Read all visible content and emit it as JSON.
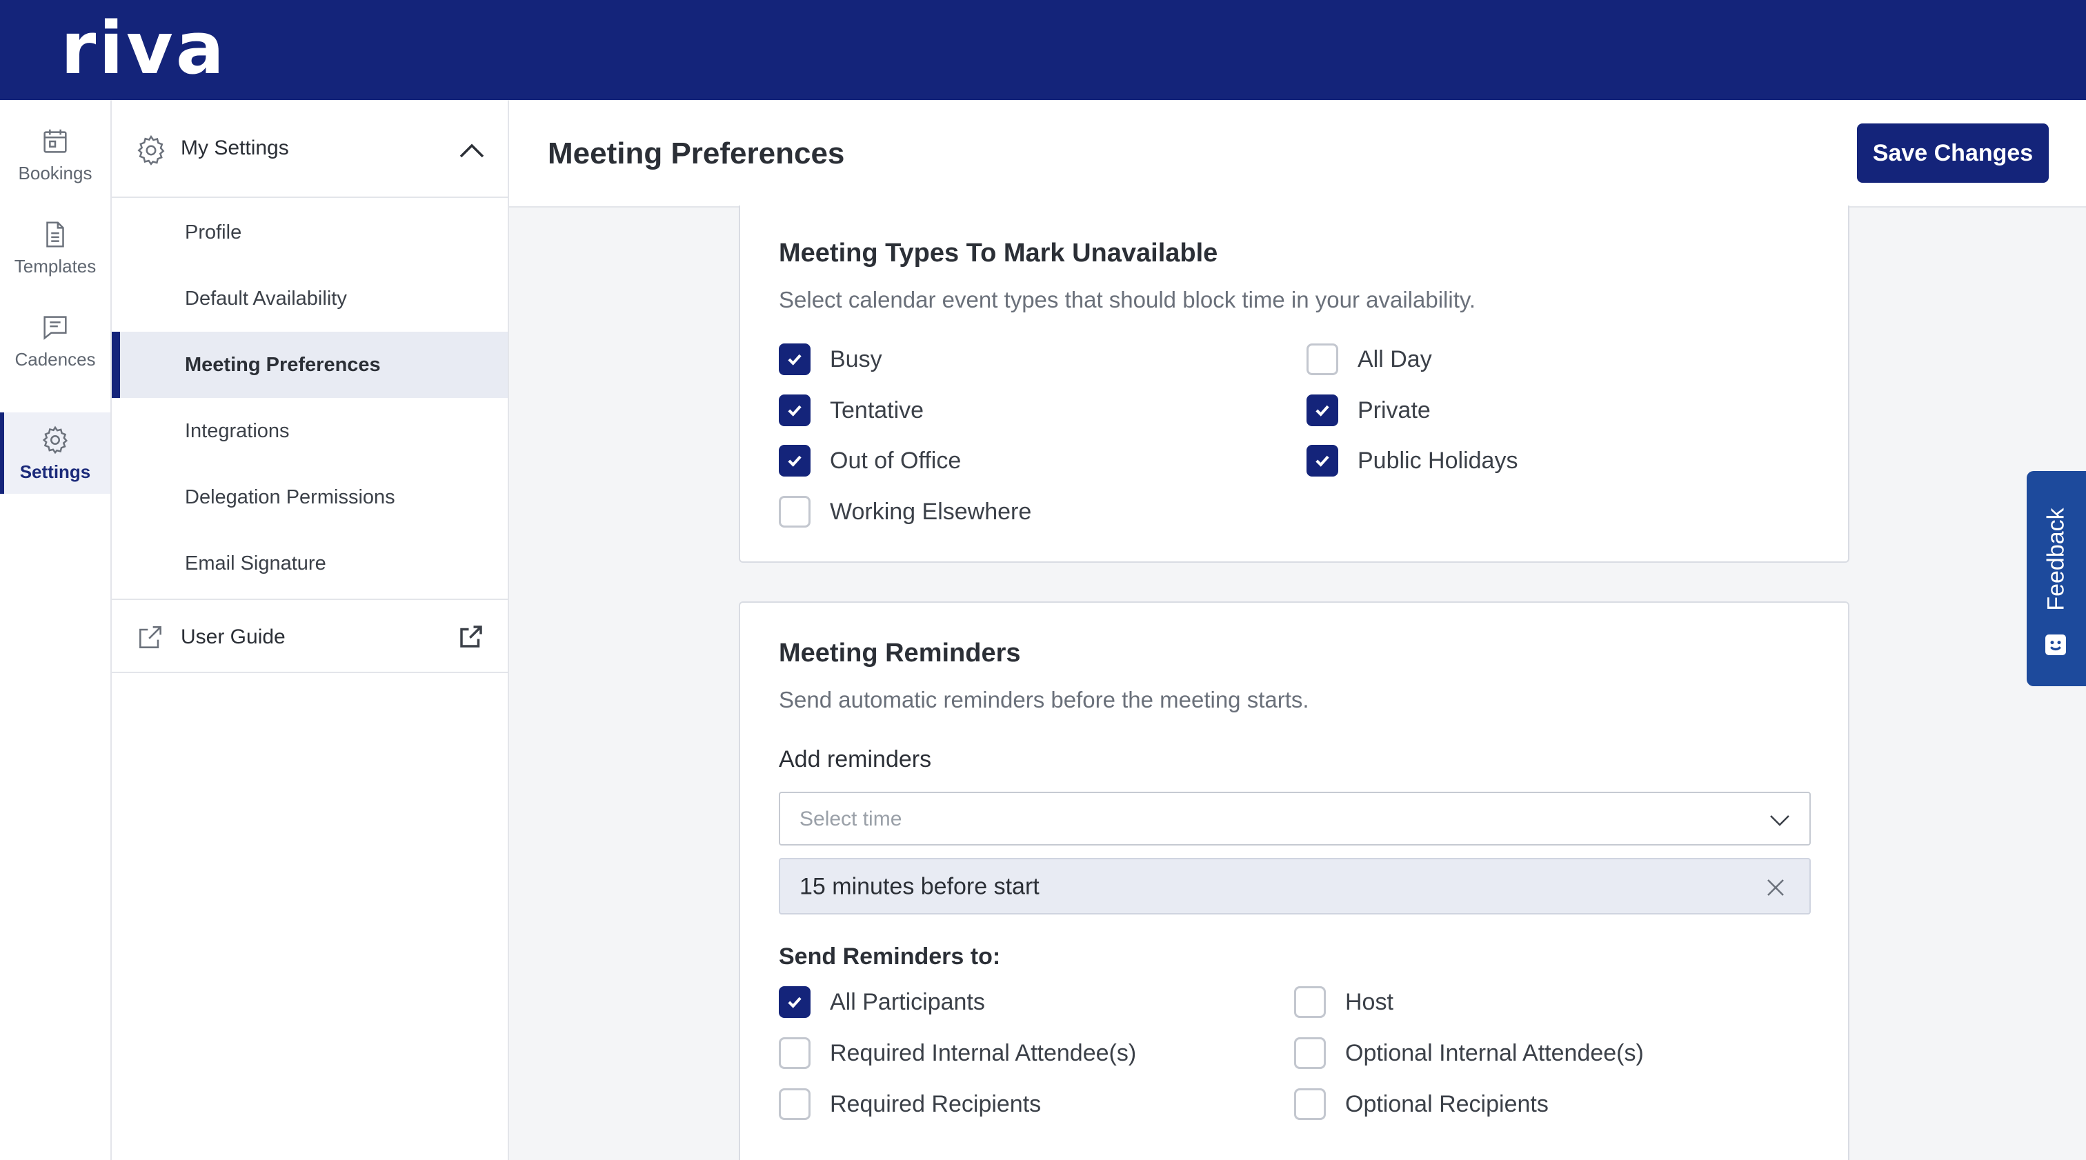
{
  "app": {
    "logo_text": "riva"
  },
  "rail": {
    "items": [
      {
        "label": "Bookings",
        "icon": "calendar-icon"
      },
      {
        "label": "Templates",
        "icon": "document-icon"
      },
      {
        "label": "Cadences",
        "icon": "message-icon"
      },
      {
        "label": "Settings",
        "icon": "gear-icon",
        "active": true
      }
    ]
  },
  "subnav": {
    "title": "My Settings",
    "items": [
      {
        "label": "Profile"
      },
      {
        "label": "Default Availability"
      },
      {
        "label": "Meeting Preferences",
        "active": true
      },
      {
        "label": "Integrations"
      },
      {
        "label": "Delegation Permissions"
      },
      {
        "label": "Email Signature"
      }
    ],
    "user_guide": "User Guide"
  },
  "header": {
    "title": "Meeting Preferences",
    "save_label": "Save Changes"
  },
  "unavailable": {
    "title": "Meeting Types To Mark Unavailable",
    "subtitle": "Select calendar event types that should block time in your availability.",
    "options": [
      {
        "label": "Busy",
        "checked": true
      },
      {
        "label": "Tentative",
        "checked": true
      },
      {
        "label": "Out of Office",
        "checked": true
      },
      {
        "label": "Working Elsewhere",
        "checked": false
      },
      {
        "label": "All Day",
        "checked": false
      },
      {
        "label": "Private",
        "checked": true
      },
      {
        "label": "Public Holidays",
        "checked": true
      }
    ]
  },
  "reminders": {
    "title": "Meeting Reminders",
    "subtitle": "Send automatic reminders before the meeting starts.",
    "add_label": "Add reminders",
    "select_placeholder": "Select time",
    "selected": "15 minutes before start",
    "send_to_label": "Send Reminders to:",
    "recipients": [
      {
        "label": "All Participants",
        "checked": true
      },
      {
        "label": "Required Internal Attendee(s)",
        "checked": false
      },
      {
        "label": "Required Recipients",
        "checked": false
      },
      {
        "label": "Host",
        "checked": false
      },
      {
        "label": "Optional Internal Attendee(s)",
        "checked": false
      },
      {
        "label": "Optional Recipients",
        "checked": false
      }
    ]
  },
  "feedback": {
    "label": "Feedback"
  },
  "colors": {
    "brand": "#14247a",
    "feedback": "#1d4a9c",
    "chip_bg": "#e8ebf3"
  }
}
